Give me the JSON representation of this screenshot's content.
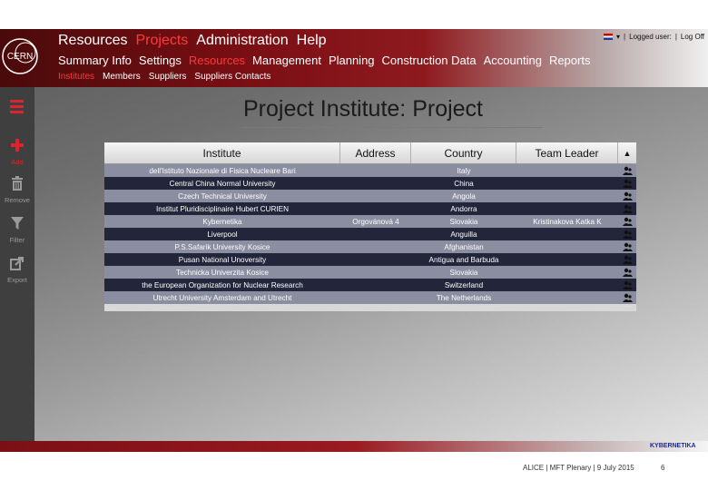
{
  "header": {
    "logo_text": "CERN",
    "nav_primary": [
      "Resources",
      "Projects",
      "Administration",
      "Help"
    ],
    "nav_primary_active": "Projects",
    "nav_secondary": [
      "Summary Info",
      "Settings",
      "Resources",
      "Management",
      "Planning",
      "Construction Data",
      "Accounting",
      "Reports"
    ],
    "nav_secondary_active": "Resources",
    "nav_tertiary": [
      "Institutes",
      "Members",
      "Suppliers",
      "Suppliers Contacts"
    ],
    "nav_tertiary_active": "Institutes",
    "user": {
      "dropdown_caret": "▾",
      "logged_user_label": "Logged user:",
      "logoff_label": "Log Off"
    }
  },
  "sidebar": {
    "items": [
      {
        "label": "Add",
        "icon": "plus-icon"
      },
      {
        "label": "Remove",
        "icon": "trash-icon"
      },
      {
        "label": "Filter",
        "icon": "filter-icon"
      },
      {
        "label": "Export",
        "icon": "export-icon"
      }
    ]
  },
  "main": {
    "title": "Project Institute: Project"
  },
  "table": {
    "columns": [
      "Institute",
      "Address",
      "Country",
      "Team Leader",
      "▲"
    ],
    "rows": [
      {
        "institute": "dell'Istituto Nazionale di Fisica Nucleare Bari",
        "address": "",
        "country": "Italy",
        "leader": ""
      },
      {
        "institute": "Central China Normal University",
        "address": "",
        "country": "China",
        "leader": ""
      },
      {
        "institute": "Czech Technical University",
        "address": "",
        "country": "Angola",
        "leader": ""
      },
      {
        "institute": "Institut Pluridisciplinaire Hubert CURIEN",
        "address": "",
        "country": "Andorra",
        "leader": ""
      },
      {
        "institute": "Kybernetika",
        "address": "Orgovánová 4",
        "country": "Slovakia",
        "leader": "Kristinakova Katka K"
      },
      {
        "institute": "Liverpool",
        "address": "",
        "country": "Anguilla",
        "leader": ""
      },
      {
        "institute": "P.S.Safarik University Kosice",
        "address": "",
        "country": "Afghanistan",
        "leader": ""
      },
      {
        "institute": "Pusan National Unoversity",
        "address": "",
        "country": "Antigua and Barbuda",
        "leader": ""
      },
      {
        "institute": "Technicka Univerzita Kosice",
        "address": "",
        "country": "Slovakia",
        "leader": ""
      },
      {
        "institute": "the European Organization for Nuclear Research",
        "address": "",
        "country": "Switzerland",
        "leader": ""
      },
      {
        "institute": "Utrecht University Amsterdam and Utrecht",
        "address": "",
        "country": "The Netherlands",
        "leader": ""
      }
    ]
  },
  "footer": {
    "brand": "KYBERNETIKA",
    "text": "ALICE | MFT Plenary | 9 July 2015",
    "page_number": "6"
  },
  "colors": {
    "accent_red": "#ff3a3a",
    "header_dark": "#7a0f14",
    "row_odd": "#8a8ea0",
    "row_even": "#23253a"
  }
}
